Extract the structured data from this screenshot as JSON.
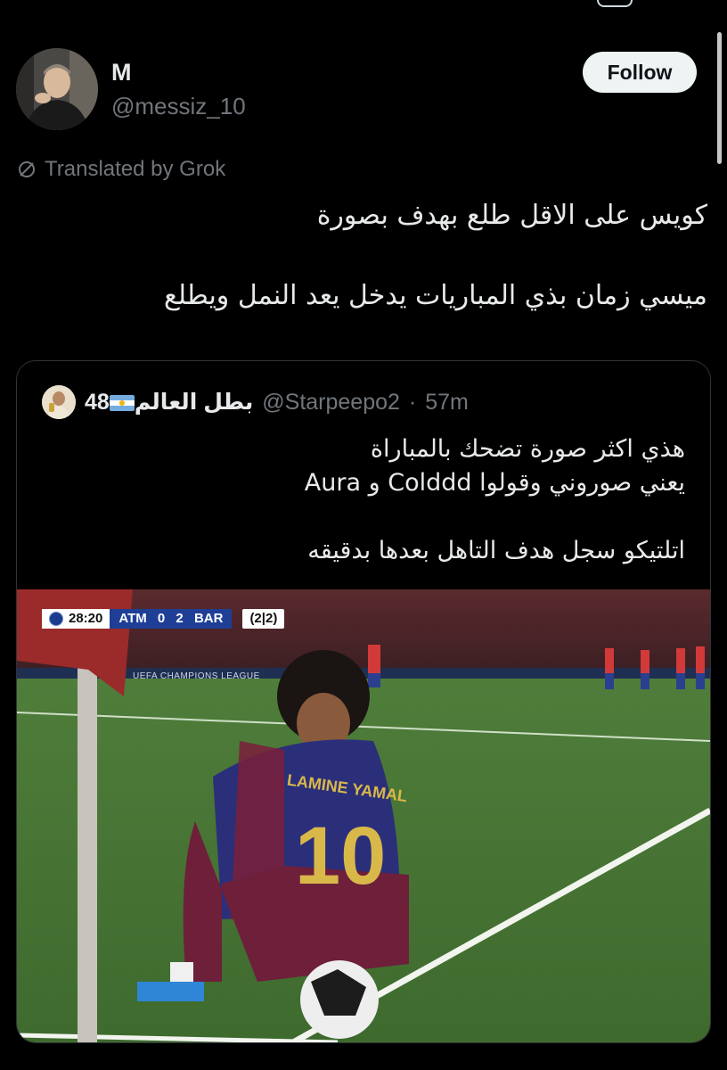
{
  "author": {
    "name": "M",
    "handle": "@messiz_10"
  },
  "follow_label": "Follow",
  "translated_label": "Translated by Grok",
  "tweet_lines": [
    "كويس على الاقل طلع بهدف بصورة",
    "ميسي زمان بذي المباريات يدخل يعد النمل ويطلع"
  ],
  "quoted": {
    "name_prefix": "بطل العالم",
    "name_suffix": "48",
    "handle": "@Starpeepo2",
    "separator": "·",
    "time": "57m",
    "lines": [
      "هذي اكثر صورة تضحك بالمباراة",
      "يعني صوروني وقولوا Colddd و Aura",
      "اتلتيكو سجل هدف التاهل بعدها بدقيقه"
    ]
  },
  "photo": {
    "scoreboard": {
      "clock": "28:20",
      "teams": "ATM 0 2 BAR",
      "aggregate": "(2|2)"
    },
    "board_text": "UEFA CHAMPIONS LEAGUE",
    "jersey_name": "LAMINE YAMAL",
    "jersey_number": "10"
  },
  "icons": {
    "translate": "translate-slash-icon",
    "ucl": "champions-league-icon"
  },
  "colors": {
    "background": "#000000",
    "text": "#e7e9ea",
    "muted": "#71767b",
    "follow_bg": "#eff3f4",
    "border": "#2f3336"
  }
}
